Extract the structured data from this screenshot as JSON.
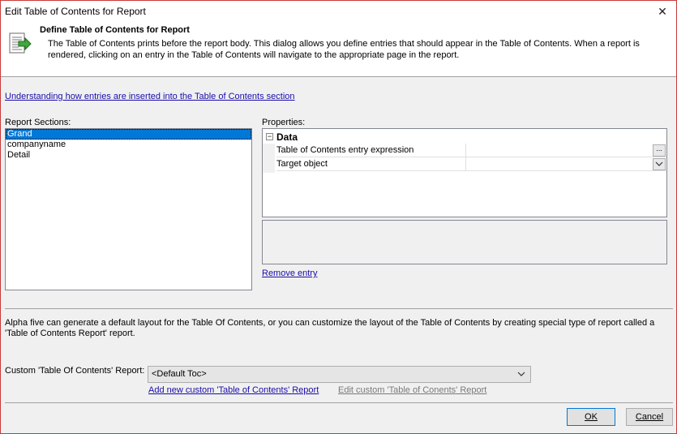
{
  "window": {
    "title": "Edit Table of Contents for Report",
    "close_glyph": "✕"
  },
  "header": {
    "title": "Define Table of Contents for Report",
    "description": "The Table of Contents prints before the report body.  This dialog allows you define entries that should appear in the Table of Contents. When a report is rendered, clicking on an entry in the Table of Contents will navigate to the appropriate page in the report.",
    "icon": "toc-green-arrow-icon"
  },
  "help_link": "Understanding how entries are inserted into the Table of Contents section",
  "report_sections": {
    "label": "Report Sections:",
    "items": [
      "Grand",
      "companyname",
      "Detail"
    ],
    "selected_index": 0
  },
  "properties": {
    "label": "Properties:",
    "category": "Data",
    "category_toggle": "−",
    "rows": [
      {
        "name": "Table of Contents entry expression",
        "value": "",
        "button": "..."
      },
      {
        "name": "Target object",
        "value": "",
        "button": "dropdown"
      }
    ],
    "remove_link": "Remove entry"
  },
  "info_text": "Alpha five can generate a default layout for the Table Of Contents, or you can customize the layout of the Table of Contents by creating special type of report called a 'Table of Contents Report' report.",
  "custom_report": {
    "label": "Custom 'Table Of Contents' Report:",
    "value": "<Default Toc>",
    "add_link": "Add new custom 'Table of Contents' Report",
    "edit_link": "Edit custom 'Table of Conents' Report"
  },
  "buttons": {
    "ok": "OK",
    "cancel": "Cancel"
  },
  "colors": {
    "selection": "#0078d7",
    "link": "#1a0dab",
    "window_border": "#c83a3a"
  }
}
